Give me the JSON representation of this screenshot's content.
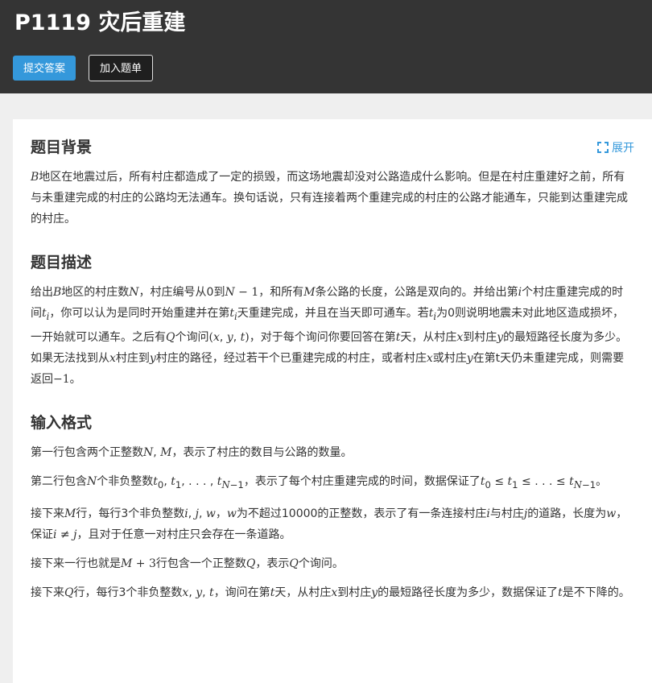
{
  "header": {
    "title": "P1119 灾后重建",
    "submit_label": "提交答案",
    "add_label": "加入题单"
  },
  "card": {
    "expand_label": "展开",
    "background": {
      "heading": "题目背景",
      "text": "B地区在地震过后，所有村庄都造成了一定的损毁，而这场地震却没对公路造成什么影响。但是在村庄重建好之前，所有与未重建完成的村庄的公路均无法通车。换句话说，只有连接着两个重建完成的村庄的公路才能通车，只能到达重建完成的村庄。"
    },
    "description": {
      "heading": "题目描述",
      "text": "给出B地区的村庄数N，村庄编号从0到N − 1，和所有M条公路的长度，公路是双向的。并给出第i个村庄重建完成的时间tᵢ，你可以认为是同时开始重建并在第tᵢ天重建完成，并且在当天即可通车。若tᵢ为0则说明地震未对此地区造成损坏，一开始就可以通车。之后有Q个询问(x, y, t)，对于每个询问你要回答在第t天，从村庄x到村庄y的最短路径长度为多少。如果无法找到从x村庄到y村庄的路径，经过若干个已重建完成的村庄，或者村庄x或村庄y在第t天仍未重建完成，则需要返回−1。"
    },
    "input": {
      "heading": "输入格式",
      "p1": "第一行包含两个正整数N, M，表示了村庄的数目与公路的数量。",
      "p2": "第二行包含N个非负整数t₀, t₁, . . . , t_{N−1}，表示了每个村庄重建完成的时间，数据保证了t₀ ≤ t₁ ≤ . . . ≤ t_{N−1}。",
      "p3": "接下来M行，每行3个非负整数i, j, w，w为不超过10000的正整数，表示了有一条连接村庄i与村庄j的道路，长度为w，保证i ≠ j，且对于任意一对村庄只会存在一条道路。",
      "p4": "接下来一行也就是M + 3行包含一个正整数Q，表示Q个询问。",
      "p5": "接下来Q行，每行3个非负整数x, y, t，询问在第t天，从村庄x到村庄y的最短路径长度为多少，数据保证了t是不下降的。"
    }
  },
  "colors": {
    "header_bg": "#343434",
    "accent": "#3498db",
    "page_bg": "#efefef"
  }
}
